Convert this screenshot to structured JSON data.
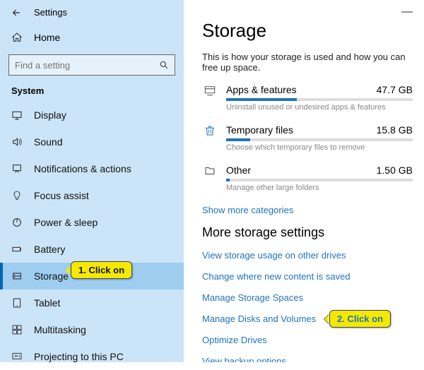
{
  "sidebar": {
    "title": "Settings",
    "home": "Home",
    "search_placeholder": "Find a setting",
    "section": "System",
    "items": [
      {
        "label": "Display"
      },
      {
        "label": "Sound"
      },
      {
        "label": "Notifications & actions"
      },
      {
        "label": "Focus assist"
      },
      {
        "label": "Power & sleep"
      },
      {
        "label": "Battery"
      },
      {
        "label": "Storage"
      },
      {
        "label": "Tablet"
      },
      {
        "label": "Multitasking"
      },
      {
        "label": "Projecting to this PC"
      }
    ]
  },
  "main": {
    "title": "Storage",
    "subtitle": "This is how your storage is used and how you can free up space.",
    "categories": [
      {
        "name": "Apps & features",
        "size": "47.7 GB",
        "sub": "Uninstall unused or undesired apps & features",
        "pct": 38
      },
      {
        "name": "Temporary files",
        "size": "15.8 GB",
        "sub": "Choose which temporary files to remove",
        "pct": 13
      },
      {
        "name": "Other",
        "size": "1.50 GB",
        "sub": "Manage other large folders",
        "pct": 2
      }
    ],
    "show_more": "Show more categories",
    "more_heading": "More storage settings",
    "links": [
      "View storage usage on other drives",
      "Change where new content is saved",
      "Manage Storage Spaces",
      "Manage Disks and Volumes",
      "Optimize Drives",
      "View backup options"
    ]
  },
  "annotations": {
    "c1": "1. Click on",
    "c2": "2. Click on"
  }
}
